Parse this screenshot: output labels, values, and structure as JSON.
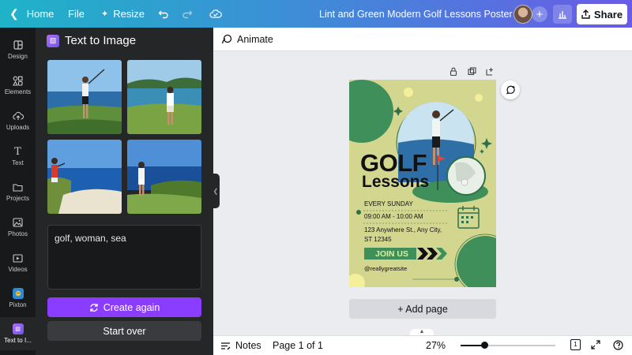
{
  "topbar": {
    "home_label": "Home",
    "file_label": "File",
    "resize_label": "Resize",
    "document_title": "Lint and Green Modern Golf Lessons Poster",
    "share_label": "Share",
    "gradient_colors": [
      "#1fb3c8",
      "#6a5be6"
    ]
  },
  "rail": {
    "items": [
      {
        "label": "Design",
        "icon": "design-icon"
      },
      {
        "label": "Elements",
        "icon": "elements-icon"
      },
      {
        "label": "Uploads",
        "icon": "upload-cloud-icon"
      },
      {
        "label": "Text",
        "icon": "text-icon"
      },
      {
        "label": "Projects",
        "icon": "folder-icon"
      },
      {
        "label": "Photos",
        "icon": "photo-icon"
      },
      {
        "label": "Videos",
        "icon": "video-icon"
      },
      {
        "label": "Pixton",
        "icon": "pixton-app-icon"
      },
      {
        "label": "Text to I...",
        "icon": "text-to-image-app-icon"
      }
    ]
  },
  "panel": {
    "title": "Text to Image",
    "prompt_text": "golf, woman, sea",
    "create_again_label": "Create again",
    "start_over_label": "Start over",
    "accent_color": "#8b3dff"
  },
  "toolbar": {
    "animate_label": "Animate"
  },
  "poster": {
    "headline_1": "GOLF",
    "headline_2": "Lessons",
    "schedule_day": "EVERY SUNDAY",
    "schedule_time": "09:00 AM - 10:00 AM",
    "address_line_1": "123 Anywhere St., Any City,",
    "address_line_2": "ST 12345",
    "cta": "JOIN US",
    "website": "@reallygreatsite",
    "background_color": "#d3d68f",
    "green_color": "#3f8f5a"
  },
  "canvas": {
    "add_page_label": "+ Add page"
  },
  "bottombar": {
    "notes_label": "Notes",
    "page_indicator": "Page 1 of 1",
    "zoom_level": "27%",
    "zoom_fraction": 0.25,
    "page_count_badge": "1"
  }
}
